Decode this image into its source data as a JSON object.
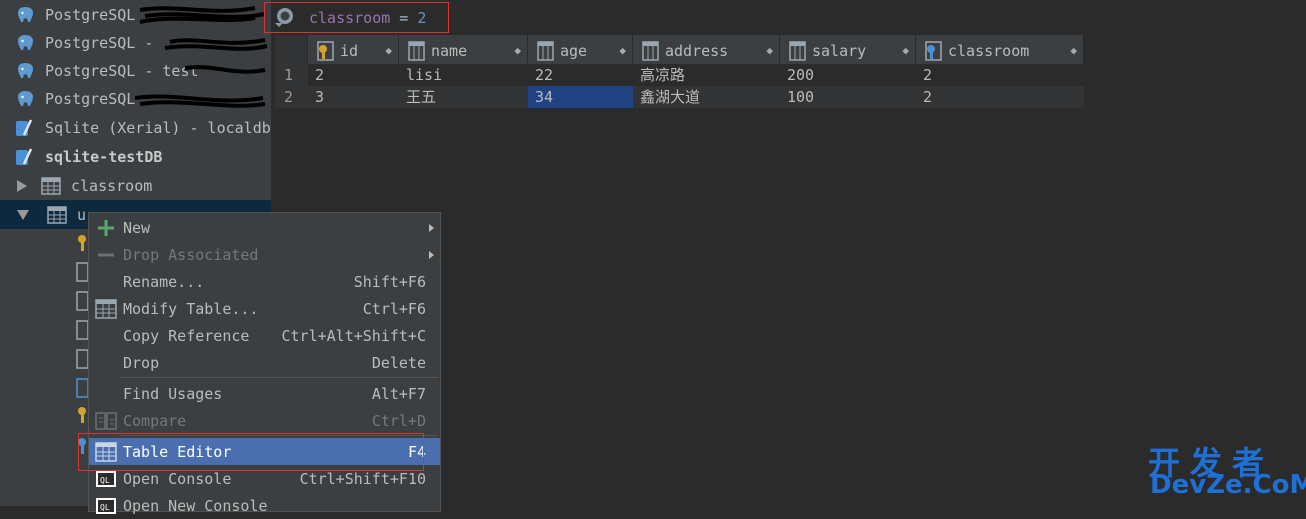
{
  "tree": {
    "items": [
      {
        "label": "PostgreSQL - ",
        "icon": "postgresql-icon"
      },
      {
        "label": "PostgreSQL - ",
        "icon": "postgresql-icon"
      },
      {
        "label": "PostgreSQL - test",
        "icon": "postgresql-icon"
      },
      {
        "label": "PostgreSQL",
        "icon": "postgresql-icon"
      },
      {
        "label": "Sqlite (Xerial) - localdb",
        "icon": "sqlite-icon"
      },
      {
        "label": "sqlite-testDB",
        "icon": "sqlite-icon"
      },
      {
        "label": "classroom",
        "icon": "table-icon"
      },
      {
        "label": "u",
        "icon": "table-icon"
      }
    ]
  },
  "filter": {
    "column": "classroom",
    "operator": "=",
    "value": "2"
  },
  "grid": {
    "columns": [
      "id",
      "name",
      "age",
      "address",
      "salary",
      "classroom"
    ],
    "rows": [
      {
        "n": "1",
        "id": "2",
        "name": "lisi",
        "age": "22",
        "address": "高凉路",
        "salary": "200",
        "classroom": "2"
      },
      {
        "n": "2",
        "id": "3",
        "name": "王五",
        "age": "34",
        "address": "鑫湖大道",
        "salary": "100",
        "classroom": "2"
      }
    ]
  },
  "menu": {
    "items": [
      {
        "label": "New",
        "shortcut": "",
        "icon": "plus-icon"
      },
      {
        "label": "Drop Associated",
        "shortcut": "",
        "icon": "minus-icon"
      },
      {
        "label": "Rename...",
        "shortcut": "Shift+F6",
        "icon": ""
      },
      {
        "label": "Modify Table...",
        "shortcut": "Ctrl+F6",
        "icon": "table-icon"
      },
      {
        "label": "Copy Reference",
        "shortcut": "Ctrl+Alt+Shift+C",
        "icon": ""
      },
      {
        "label": "Drop",
        "shortcut": "Delete",
        "icon": ""
      },
      {
        "label": "Find Usages",
        "shortcut": "Alt+F7",
        "icon": ""
      },
      {
        "label": "Compare",
        "shortcut": "Ctrl+D",
        "icon": "compare-icon"
      },
      {
        "label": "Table Editor",
        "shortcut": "F4",
        "icon": "table-icon"
      },
      {
        "label": "Open Console",
        "shortcut": "Ctrl+Shift+F10",
        "icon": "console-icon"
      },
      {
        "label": "Open New Console",
        "shortcut": "",
        "icon": "console-icon"
      }
    ]
  },
  "watermark": {
    "line1": "开发者",
    "line2": "DevZe.CoM"
  },
  "colors": {
    "selection": "#214283",
    "menu_active": "#4b6eaf",
    "highlight_border": "#dd3333",
    "watermark": "#1e6fd6"
  }
}
